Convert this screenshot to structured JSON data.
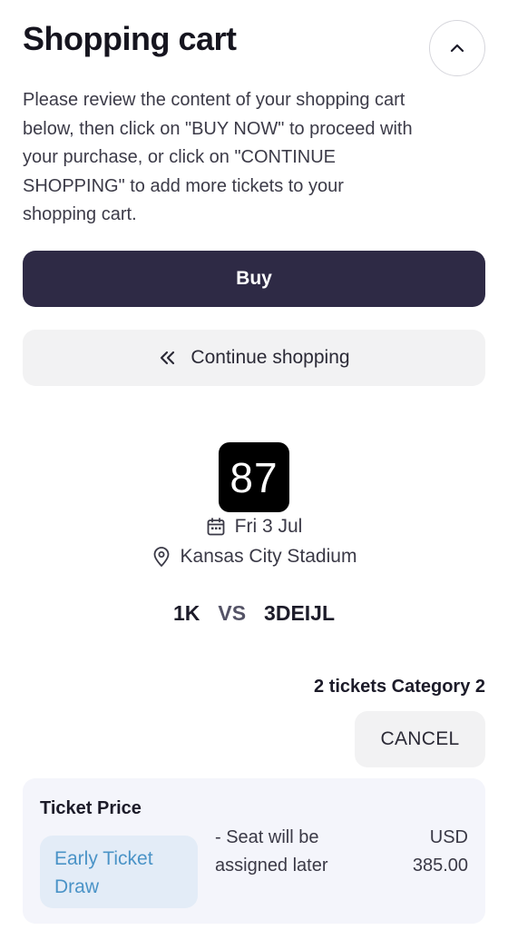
{
  "header": {
    "title": "Shopping cart",
    "collapse_icon": "chevron-up-icon"
  },
  "intro_text": "Please review the content of your shopping cart below, then click on \"BUY NOW\" to proceed with your purchase, or click on \"CONTINUE SHOPPING\" to add more tickets to your shopping cart.",
  "actions": {
    "buy_label": "Buy",
    "continue_label": "Continue shopping",
    "continue_icon": "double-chevron-left-icon"
  },
  "event": {
    "number": "87",
    "date": "Fri 3 Jul",
    "date_icon": "calendar-icon",
    "venue": "Kansas City Stadium",
    "venue_icon": "location-pin-icon",
    "team_home": "1K",
    "vs": "VS",
    "team_away": "3DEIJL"
  },
  "cart_item": {
    "summary": "2 tickets Category 2",
    "cancel_label": "CANCEL",
    "price_label": "Ticket Price",
    "price_tag": "Early Ticket Draw",
    "note": "- Seat will be assigned later",
    "currency": "USD",
    "amount": "385.00"
  },
  "colors": {
    "primary_button": "#2e2a45",
    "secondary_button": "#f2f2f3",
    "tag_text": "#4a93c7",
    "tag_bg": "#e3ecf7",
    "card_bg": "#f4f5fb"
  }
}
